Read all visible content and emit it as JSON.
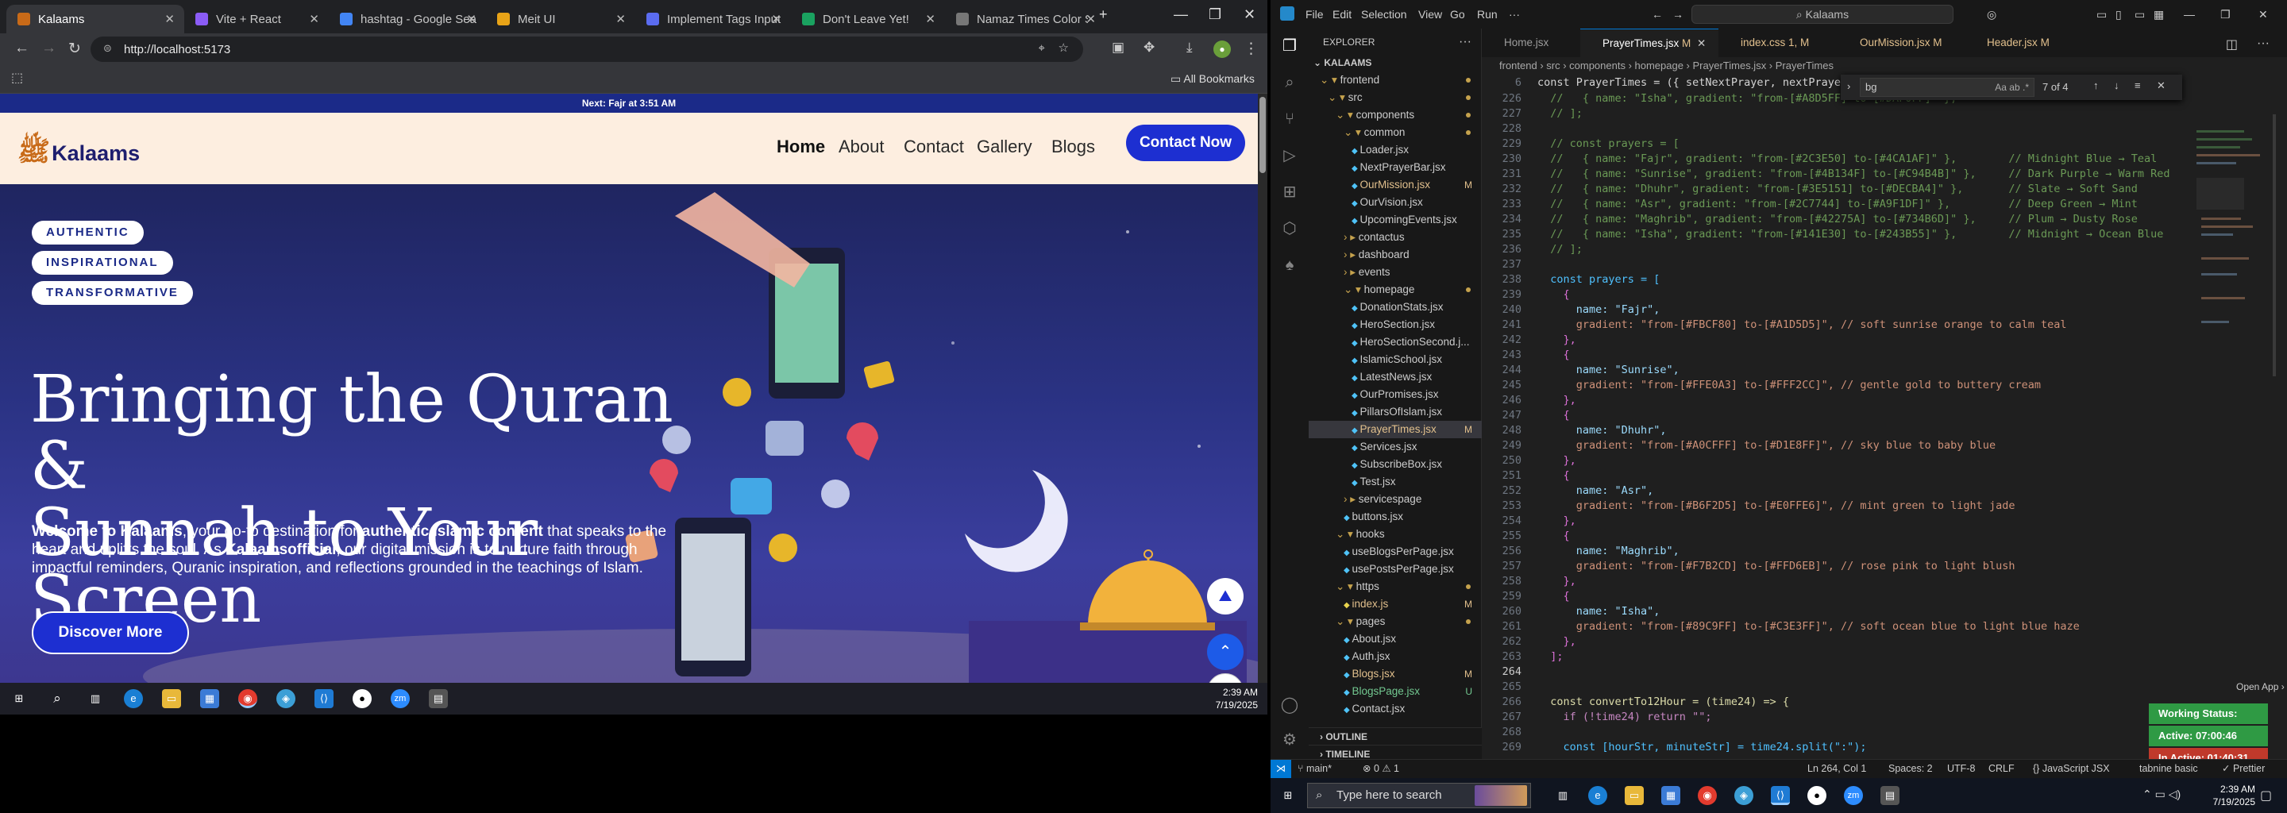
{
  "browser": {
    "tabs": [
      {
        "title": "Kalaams",
        "active": true,
        "color": "#c86a18"
      },
      {
        "title": "Vite + React",
        "active": false,
        "color": "#8b5cf6"
      },
      {
        "title": "hashtag - Google Sea",
        "active": false,
        "color": "#4285f4"
      },
      {
        "title": "Meit UI",
        "active": false,
        "color": "#e8a317"
      },
      {
        "title": "Implement Tags Input",
        "active": false,
        "color": "#5b6cf0"
      },
      {
        "title": "Don't Leave Yet!",
        "active": false,
        "color": "#1aa260"
      },
      {
        "title": "Namaz Times Color Sc",
        "active": false,
        "color": "#777777"
      }
    ],
    "url": "http://localhost:5173",
    "bookmarks_label": "All Bookmarks"
  },
  "site": {
    "prayer_bar": "Next: Fajr at 3:51 AM",
    "logo_text": "Kalaams",
    "logo_mark": "ﷺ",
    "nav": [
      "Home",
      "About",
      "Contact",
      "Gallery",
      "Blogs"
    ],
    "contact_button": "Contact Now",
    "pills": [
      "AUTHENTIC",
      "INSPIRATIONAL",
      "TRANSFORMATIVE"
    ],
    "heading_line1": "Bringing the Quran &",
    "heading_line2": "Sunnah to Your Screen",
    "para_lead": "Welcome to Kalaams",
    "para_1": ", your go-to destination for ",
    "para_bold_1": "authentic Islamic content",
    "para_2": " that speaks to the heart and uplifts the soul. As ",
    "para_bold_2": "Kalaamsofficial",
    "para_3": ", our digital mission is to nurture faith through impactful reminders, Quranic inspiration, and reflections grounded in the teachings of Islam.",
    "discover_button": "Discover More",
    "accent": "#1d2fd1",
    "nav_bg": "#fdeee0"
  },
  "left_clock": {
    "time": "2:39 AM",
    "date": "7/19/2025"
  },
  "vscode": {
    "menu": [
      "File",
      "Edit",
      "Selection",
      "View",
      "Go",
      "Run",
      "···"
    ],
    "command_center": "Kalaams",
    "explorer_title": "EXPLORER",
    "workspace": "KALAAMS",
    "tree": [
      {
        "label": "frontend",
        "indent": 1,
        "kind": "folder-open",
        "dot": true
      },
      {
        "label": "src",
        "indent": 2,
        "kind": "folder-open",
        "dot": true
      },
      {
        "label": "components",
        "indent": 3,
        "kind": "folder-open",
        "dot": true
      },
      {
        "label": "common",
        "indent": 4,
        "kind": "folder-open",
        "dot": true
      },
      {
        "label": "Loader.jsx",
        "indent": 5,
        "kind": "file"
      },
      {
        "label": "NextPrayerBar.jsx",
        "indent": 5,
        "kind": "file"
      },
      {
        "label": "OurMission.jsx",
        "indent": 5,
        "kind": "file",
        "badge": "M",
        "modified": true
      },
      {
        "label": "OurVision.jsx",
        "indent": 5,
        "kind": "file"
      },
      {
        "label": "UpcomingEvents.jsx",
        "indent": 5,
        "kind": "file"
      },
      {
        "label": "contactus",
        "indent": 4,
        "kind": "folder"
      },
      {
        "label": "dashboard",
        "indent": 4,
        "kind": "folder"
      },
      {
        "label": "events",
        "indent": 4,
        "kind": "folder"
      },
      {
        "label": "homepage",
        "indent": 4,
        "kind": "folder-open",
        "dot": true
      },
      {
        "label": "DonationStats.jsx",
        "indent": 5,
        "kind": "file"
      },
      {
        "label": "HeroSection.jsx",
        "indent": 5,
        "kind": "file"
      },
      {
        "label": "HeroSectionSecond.j...",
        "indent": 5,
        "kind": "file"
      },
      {
        "label": "IslamicSchool.jsx",
        "indent": 5,
        "kind": "file"
      },
      {
        "label": "LatestNews.jsx",
        "indent": 5,
        "kind": "file"
      },
      {
        "label": "OurPromises.jsx",
        "indent": 5,
        "kind": "file"
      },
      {
        "label": "PillarsOfIslam.jsx",
        "indent": 5,
        "kind": "file"
      },
      {
        "label": "PrayerTimes.jsx",
        "indent": 5,
        "kind": "file",
        "badge": "M",
        "modified": true,
        "selected": true
      },
      {
        "label": "Services.jsx",
        "indent": 5,
        "kind": "file"
      },
      {
        "label": "SubscribeBox.jsx",
        "indent": 5,
        "kind": "file"
      },
      {
        "label": "Test.jsx",
        "indent": 5,
        "kind": "file"
      },
      {
        "label": "servicespage",
        "indent": 4,
        "kind": "folder"
      },
      {
        "label": "buttons.jsx",
        "indent": 4,
        "kind": "file"
      },
      {
        "label": "hooks",
        "indent": 3,
        "kind": "folder-open"
      },
      {
        "label": "useBlogsPerPage.jsx",
        "indent": 4,
        "kind": "file"
      },
      {
        "label": "usePostsPerPage.jsx",
        "indent": 4,
        "kind": "file"
      },
      {
        "label": "https",
        "indent": 3,
        "kind": "folder-open",
        "dot": true
      },
      {
        "label": "index.js",
        "indent": 4,
        "kind": "file",
        "badge": "M",
        "modified": true
      },
      {
        "label": "pages",
        "indent": 3,
        "kind": "folder-open",
        "dot": true
      },
      {
        "label": "About.jsx",
        "indent": 4,
        "kind": "file"
      },
      {
        "label": "Auth.jsx",
        "indent": 4,
        "kind": "file"
      },
      {
        "label": "Blogs.jsx",
        "indent": 4,
        "kind": "file",
        "badge": "M",
        "modified": true
      },
      {
        "label": "BlogsPage.jsx",
        "indent": 4,
        "kind": "file",
        "badge": "U",
        "untracked": true
      },
      {
        "label": "Contact.jsx",
        "indent": 4,
        "kind": "file"
      }
    ],
    "outline_label": "OUTLINE",
    "timeline_label": "TIMELINE",
    "tabs": [
      {
        "label": "Home.jsx",
        "badge": ""
      },
      {
        "label": "PrayerTimes.jsx",
        "badge": "M",
        "active": true
      },
      {
        "label": "index.css",
        "badge": "1, M"
      },
      {
        "label": "OurMission.jsx",
        "badge": "M"
      },
      {
        "label": "Header.jsx",
        "badge": "M"
      }
    ],
    "breadcrumb": "frontend › src › components › homepage › PrayerTimes.jsx › PrayerTimes",
    "find": {
      "query": "bg",
      "result": "7 of 4"
    },
    "sticky_line": {
      "num": "6",
      "text": "const PrayerTimes = ({ setNextPrayer, nextPrayer }) => {"
    },
    "lines": [
      {
        "n": "226",
        "t": "  //   { name: \"Isha\", gradient: \"from-[#A8D5FF] to-[#DAF0FF]\" },",
        "k": "com"
      },
      {
        "n": "227",
        "t": "  // ];",
        "k": "com"
      },
      {
        "n": "228",
        "t": "",
        "k": ""
      },
      {
        "n": "229",
        "t": "  // const prayers = [",
        "k": "com"
      },
      {
        "n": "230",
        "t": "  //   { name: \"Fajr\", gradient: \"from-[#2C3E50] to-[#4CA1AF]\" },        // Midnight Blue → Teal",
        "k": "com"
      },
      {
        "n": "231",
        "t": "  //   { name: \"Sunrise\", gradient: \"from-[#4B134F] to-[#C94B4B]\" },     // Dark Purple → Warm Red",
        "k": "com"
      },
      {
        "n": "232",
        "t": "  //   { name: \"Dhuhr\", gradient: \"from-[#3E5151] to-[#DECBA4]\" },       // Slate → Soft Sand",
        "k": "com"
      },
      {
        "n": "233",
        "t": "  //   { name: \"Asr\", gradient: \"from-[#2C7744] to-[#A9F1DF]\" },         // Deep Green → Mint",
        "k": "com"
      },
      {
        "n": "234",
        "t": "  //   { name: \"Maghrib\", gradient: \"from-[#42275A] to-[#734B6D]\" },     // Plum → Dusty Rose",
        "k": "com"
      },
      {
        "n": "235",
        "t": "  //   { name: \"Isha\", gradient: \"from-[#141E30] to-[#243B55]\" },        // Midnight → Ocean Blue",
        "k": "com"
      },
      {
        "n": "236",
        "t": "  // ];",
        "k": "com"
      },
      {
        "n": "237",
        "t": "",
        "k": ""
      },
      {
        "n": "238",
        "t": "  const prayers = [",
        "k": "decl"
      },
      {
        "n": "239",
        "t": "    {",
        "k": "br"
      },
      {
        "n": "240",
        "t": "      name: \"Fajr\",",
        "k": "prop"
      },
      {
        "n": "241",
        "t": "      gradient: \"from-[#FBCF80] to-[#A1D5D5]\", // soft sunrise orange to calm teal",
        "k": "propc"
      },
      {
        "n": "242",
        "t": "    },",
        "k": "br"
      },
      {
        "n": "243",
        "t": "    {",
        "k": "br"
      },
      {
        "n": "244",
        "t": "      name: \"Sunrise\",",
        "k": "prop"
      },
      {
        "n": "245",
        "t": "      gradient: \"from-[#FFE0A3] to-[#FFF2CC]\", // gentle gold to buttery cream",
        "k": "propc"
      },
      {
        "n": "246",
        "t": "    },",
        "k": "br"
      },
      {
        "n": "247",
        "t": "    {",
        "k": "br"
      },
      {
        "n": "248",
        "t": "      name: \"Dhuhr\",",
        "k": "prop"
      },
      {
        "n": "249",
        "t": "      gradient: \"from-[#A0CFFF] to-[#D1E8FF]\", // sky blue to baby blue",
        "k": "propc"
      },
      {
        "n": "250",
        "t": "    },",
        "k": "br"
      },
      {
        "n": "251",
        "t": "    {",
        "k": "br"
      },
      {
        "n": "252",
        "t": "      name: \"Asr\",",
        "k": "prop"
      },
      {
        "n": "253",
        "t": "      gradient: \"from-[#B6F2D5] to-[#E0FFE6]\", // mint green to light jade",
        "k": "propc"
      },
      {
        "n": "254",
        "t": "    },",
        "k": "br"
      },
      {
        "n": "255",
        "t": "    {",
        "k": "br"
      },
      {
        "n": "256",
        "t": "      name: \"Maghrib\",",
        "k": "prop"
      },
      {
        "n": "257",
        "t": "      gradient: \"from-[#F7B2CD] to-[#FFD6EB]\", // rose pink to light blush",
        "k": "propc"
      },
      {
        "n": "258",
        "t": "    },",
        "k": "br"
      },
      {
        "n": "259",
        "t": "    {",
        "k": "br"
      },
      {
        "n": "260",
        "t": "      name: \"Isha\",",
        "k": "prop"
      },
      {
        "n": "261",
        "t": "      gradient: \"from-[#89C9FF] to-[#C3E3FF]\", // soft ocean blue to light blue haze",
        "k": "propc"
      },
      {
        "n": "262",
        "t": "    },",
        "k": "br"
      },
      {
        "n": "263",
        "t": "  ];",
        "k": "br"
      },
      {
        "n": "264",
        "t": "",
        "k": "",
        "cur": true
      },
      {
        "n": "265",
        "t": "",
        "k": ""
      },
      {
        "n": "266",
        "t": "  const convertTo12Hour = (time24) => {",
        "k": "fnl"
      },
      {
        "n": "267",
        "t": "    if (!time24) return \"\";",
        "k": "ifl"
      },
      {
        "n": "268",
        "t": "",
        "k": ""
      },
      {
        "n": "269",
        "t": "    const [hourStr, minuteStr] = time24.split(\":\");",
        "k": "decl2"
      }
    ],
    "open_app": "Open App ›",
    "working_status": "Working Status: Active",
    "active_time": "Active: 07:00:46",
    "inactive_time": "In Active: 01:40:31",
    "status": {
      "branch": "main*",
      "problems": "⊗ 0 ⚠ 1",
      "position": "Ln 264, Col 1",
      "spaces": "Spaces: 2",
      "encoding": "UTF-8",
      "eol": "CRLF",
      "language": "{} JavaScript JSX",
      "tabnine": "tabnine basic",
      "prettier": "✓ Prettier"
    }
  },
  "windows": {
    "search_placeholder": "Type here to search",
    "time": "2:39 AM",
    "date": "7/19/2025"
  }
}
